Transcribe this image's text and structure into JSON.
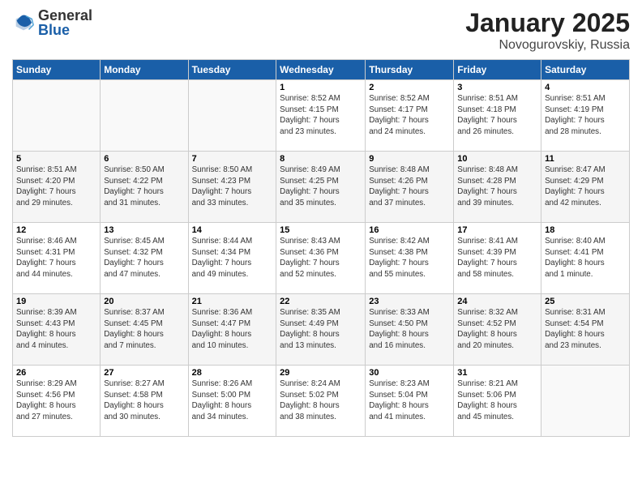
{
  "header": {
    "logo_general": "General",
    "logo_blue": "Blue",
    "month": "January 2025",
    "location": "Novogurovskiy, Russia"
  },
  "days_of_week": [
    "Sunday",
    "Monday",
    "Tuesday",
    "Wednesday",
    "Thursday",
    "Friday",
    "Saturday"
  ],
  "weeks": [
    [
      {
        "day": "",
        "detail": ""
      },
      {
        "day": "",
        "detail": ""
      },
      {
        "day": "",
        "detail": ""
      },
      {
        "day": "1",
        "detail": "Sunrise: 8:52 AM\nSunset: 4:15 PM\nDaylight: 7 hours\nand 23 minutes."
      },
      {
        "day": "2",
        "detail": "Sunrise: 8:52 AM\nSunset: 4:17 PM\nDaylight: 7 hours\nand 24 minutes."
      },
      {
        "day": "3",
        "detail": "Sunrise: 8:51 AM\nSunset: 4:18 PM\nDaylight: 7 hours\nand 26 minutes."
      },
      {
        "day": "4",
        "detail": "Sunrise: 8:51 AM\nSunset: 4:19 PM\nDaylight: 7 hours\nand 28 minutes."
      }
    ],
    [
      {
        "day": "5",
        "detail": "Sunrise: 8:51 AM\nSunset: 4:20 PM\nDaylight: 7 hours\nand 29 minutes."
      },
      {
        "day": "6",
        "detail": "Sunrise: 8:50 AM\nSunset: 4:22 PM\nDaylight: 7 hours\nand 31 minutes."
      },
      {
        "day": "7",
        "detail": "Sunrise: 8:50 AM\nSunset: 4:23 PM\nDaylight: 7 hours\nand 33 minutes."
      },
      {
        "day": "8",
        "detail": "Sunrise: 8:49 AM\nSunset: 4:25 PM\nDaylight: 7 hours\nand 35 minutes."
      },
      {
        "day": "9",
        "detail": "Sunrise: 8:48 AM\nSunset: 4:26 PM\nDaylight: 7 hours\nand 37 minutes."
      },
      {
        "day": "10",
        "detail": "Sunrise: 8:48 AM\nSunset: 4:28 PM\nDaylight: 7 hours\nand 39 minutes."
      },
      {
        "day": "11",
        "detail": "Sunrise: 8:47 AM\nSunset: 4:29 PM\nDaylight: 7 hours\nand 42 minutes."
      }
    ],
    [
      {
        "day": "12",
        "detail": "Sunrise: 8:46 AM\nSunset: 4:31 PM\nDaylight: 7 hours\nand 44 minutes."
      },
      {
        "day": "13",
        "detail": "Sunrise: 8:45 AM\nSunset: 4:32 PM\nDaylight: 7 hours\nand 47 minutes."
      },
      {
        "day": "14",
        "detail": "Sunrise: 8:44 AM\nSunset: 4:34 PM\nDaylight: 7 hours\nand 49 minutes."
      },
      {
        "day": "15",
        "detail": "Sunrise: 8:43 AM\nSunset: 4:36 PM\nDaylight: 7 hours\nand 52 minutes."
      },
      {
        "day": "16",
        "detail": "Sunrise: 8:42 AM\nSunset: 4:38 PM\nDaylight: 7 hours\nand 55 minutes."
      },
      {
        "day": "17",
        "detail": "Sunrise: 8:41 AM\nSunset: 4:39 PM\nDaylight: 7 hours\nand 58 minutes."
      },
      {
        "day": "18",
        "detail": "Sunrise: 8:40 AM\nSunset: 4:41 PM\nDaylight: 8 hours\nand 1 minute."
      }
    ],
    [
      {
        "day": "19",
        "detail": "Sunrise: 8:39 AM\nSunset: 4:43 PM\nDaylight: 8 hours\nand 4 minutes."
      },
      {
        "day": "20",
        "detail": "Sunrise: 8:37 AM\nSunset: 4:45 PM\nDaylight: 8 hours\nand 7 minutes."
      },
      {
        "day": "21",
        "detail": "Sunrise: 8:36 AM\nSunset: 4:47 PM\nDaylight: 8 hours\nand 10 minutes."
      },
      {
        "day": "22",
        "detail": "Sunrise: 8:35 AM\nSunset: 4:49 PM\nDaylight: 8 hours\nand 13 minutes."
      },
      {
        "day": "23",
        "detail": "Sunrise: 8:33 AM\nSunset: 4:50 PM\nDaylight: 8 hours\nand 16 minutes."
      },
      {
        "day": "24",
        "detail": "Sunrise: 8:32 AM\nSunset: 4:52 PM\nDaylight: 8 hours\nand 20 minutes."
      },
      {
        "day": "25",
        "detail": "Sunrise: 8:31 AM\nSunset: 4:54 PM\nDaylight: 8 hours\nand 23 minutes."
      }
    ],
    [
      {
        "day": "26",
        "detail": "Sunrise: 8:29 AM\nSunset: 4:56 PM\nDaylight: 8 hours\nand 27 minutes."
      },
      {
        "day": "27",
        "detail": "Sunrise: 8:27 AM\nSunset: 4:58 PM\nDaylight: 8 hours\nand 30 minutes."
      },
      {
        "day": "28",
        "detail": "Sunrise: 8:26 AM\nSunset: 5:00 PM\nDaylight: 8 hours\nand 34 minutes."
      },
      {
        "day": "29",
        "detail": "Sunrise: 8:24 AM\nSunset: 5:02 PM\nDaylight: 8 hours\nand 38 minutes."
      },
      {
        "day": "30",
        "detail": "Sunrise: 8:23 AM\nSunset: 5:04 PM\nDaylight: 8 hours\nand 41 minutes."
      },
      {
        "day": "31",
        "detail": "Sunrise: 8:21 AM\nSunset: 5:06 PM\nDaylight: 8 hours\nand 45 minutes."
      },
      {
        "day": "",
        "detail": ""
      }
    ]
  ]
}
